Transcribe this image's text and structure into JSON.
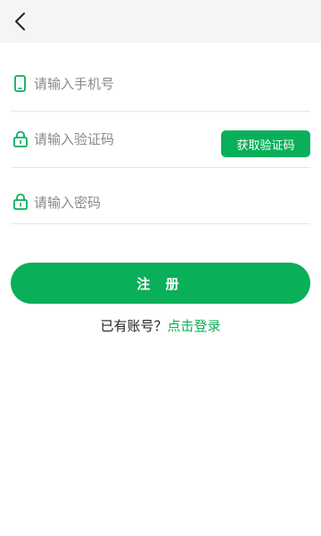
{
  "colors": {
    "accent": "#0aaf5a",
    "topbar_bg": "#f5f5f5",
    "divider": "#e6e6e6",
    "placeholder": "#8a8a8a"
  },
  "header": {
    "back_icon": "chevron-left-icon"
  },
  "form": {
    "phone": {
      "icon": "phone-icon",
      "placeholder": "请输入手机号",
      "value": ""
    },
    "code": {
      "icon": "lock-icon",
      "placeholder": "请输入验证码",
      "value": "",
      "button_label": "获取验证码"
    },
    "password": {
      "icon": "lock-icon",
      "placeholder": "请输入密码",
      "value": ""
    }
  },
  "register_button": {
    "label": "注 册"
  },
  "login_prompt": {
    "text": "已有账号？",
    "link": "点击登录"
  }
}
